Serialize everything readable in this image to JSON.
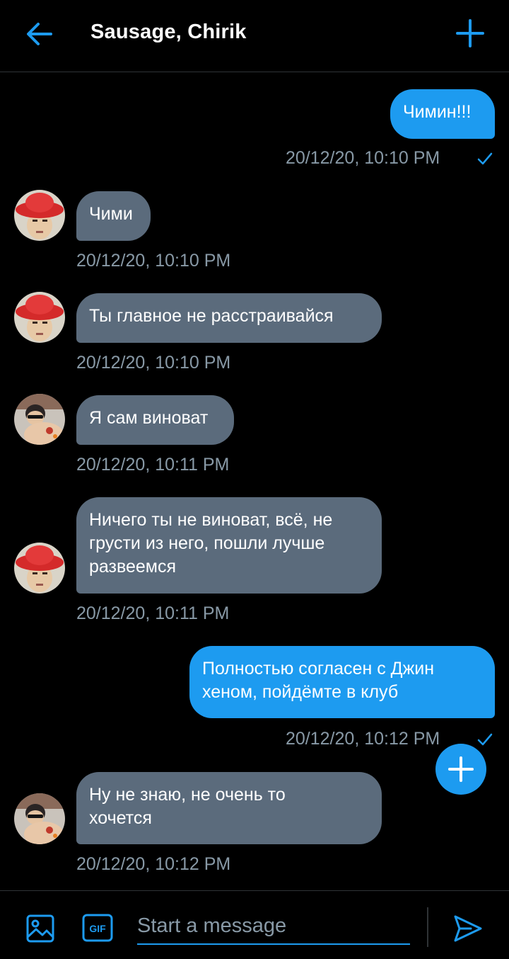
{
  "header": {
    "title": "Sausage, Chirik",
    "back_icon": "arrow-left-icon",
    "add_icon": "plus-icon"
  },
  "colors": {
    "accent": "#1d9bf0",
    "incoming_bubble": "#5b6b7c",
    "timestamp": "#8899a6",
    "background": "#000000"
  },
  "messages": [
    {
      "direction": "out",
      "text": "Чимин!!!",
      "time": "20/12/20, 10:10 PM",
      "read": true
    },
    {
      "direction": "in",
      "sender": "red-hat",
      "text": "Чими",
      "time": "20/12/20, 10:10 PM"
    },
    {
      "direction": "in",
      "sender": "red-hat",
      "text": "Ты главное не расстраивайся",
      "time": "20/12/20, 10:10 PM"
    },
    {
      "direction": "in",
      "sender": "sunglasses",
      "text": "Я сам виноват",
      "time": "20/12/20, 10:11 PM"
    },
    {
      "direction": "in",
      "sender": "red-hat",
      "text": "Ничего ты не виноват, всё, не\nгрусти из него, пошли лучше\nразвеемся",
      "time": "20/12/20, 10:11 PM"
    },
    {
      "direction": "out",
      "text": "Полностью согласен с Джин\nхеном, пойдёмте в клуб",
      "time": "20/12/20, 10:12 PM",
      "read": true
    },
    {
      "direction": "in",
      "sender": "sunglasses",
      "text": "Ну не знаю, не очень то\nхочется",
      "time": "20/12/20, 10:12 PM"
    }
  ],
  "composer": {
    "placeholder": "Start a message",
    "media_icon": "image-icon",
    "gif_icon": "gif-icon",
    "gif_label": "GIF",
    "send_icon": "send-icon"
  },
  "fab_icon": "plus-icon"
}
